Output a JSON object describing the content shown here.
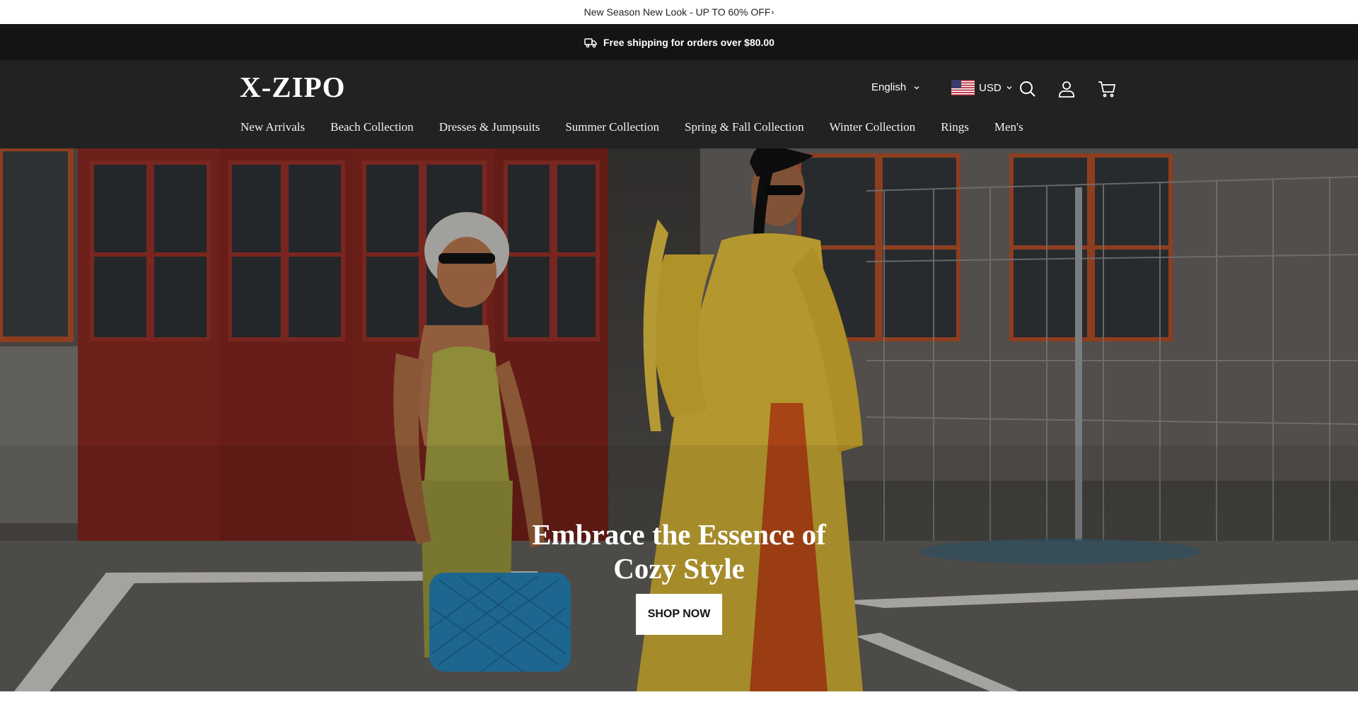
{
  "announcement": {
    "text": "New Season New Look - UP TO 60% OFF",
    "arrow": "›"
  },
  "shipping_bar": {
    "text": "Free shipping for orders over $80.00",
    "icon": "truck-icon"
  },
  "header": {
    "logo": "X-ZIPO",
    "language": "English",
    "currency": "USD",
    "icons": [
      "search-icon",
      "account-icon",
      "cart-icon"
    ]
  },
  "nav": {
    "items": [
      {
        "label": "New Arrivals"
      },
      {
        "label": "Beach Collection"
      },
      {
        "label": "Dresses & Jumpsuits"
      },
      {
        "label": "Summer Collection"
      },
      {
        "label": "Spring & Fall Collection"
      },
      {
        "label": "Winter Collection"
      },
      {
        "label": "Rings"
      },
      {
        "label": "Men's"
      }
    ]
  },
  "hero": {
    "title": "Embrace the Essence of Cozy Style",
    "button_label": "SHOP NOW"
  },
  "colors": {
    "header_bg": "#222222",
    "shipbar_bg": "#141414",
    "door_red": "#8e2a22",
    "window_orange": "#b5502a",
    "yellow_dress": "#e7c23c",
    "orange_panel": "#d8571c",
    "bag_blue": "#2a8fc9"
  }
}
